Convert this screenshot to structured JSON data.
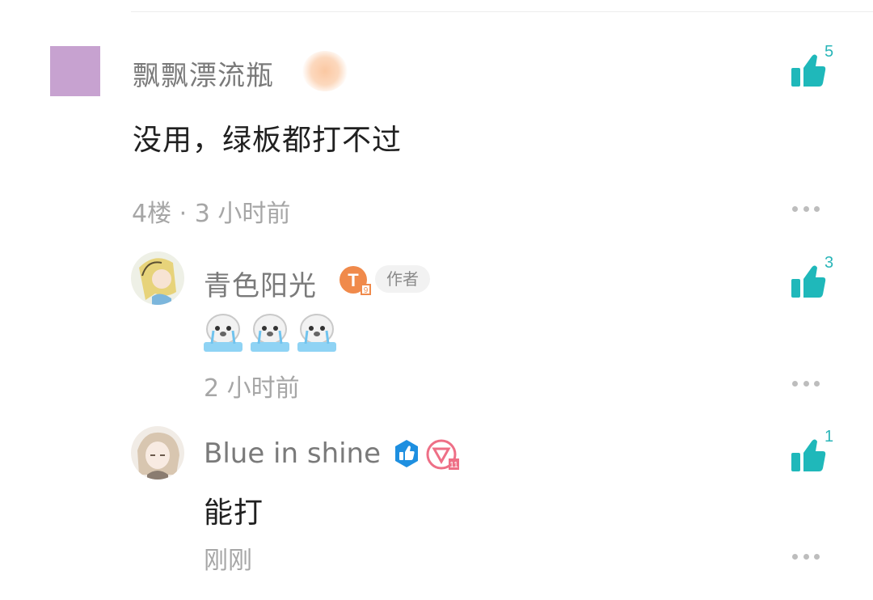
{
  "comments": [
    {
      "username": "飘飘漂流瓶",
      "text": "没用，绿板都打不过",
      "meta": "4楼 · 3 小时前",
      "likes": "5",
      "avatar_color": "#c7a2d0"
    }
  ],
  "replies": [
    {
      "username": "青色阳光",
      "author_badge": "作者",
      "level_badge": "T",
      "emoji_count": 3,
      "meta": "2 小时前",
      "likes": "3"
    },
    {
      "username": "Blue in shine",
      "text": "能打",
      "meta": "刚刚",
      "likes": "1"
    }
  ],
  "colors": {
    "accent": "#29b5b8",
    "like_icon": "#1fb8ba",
    "meta_text": "#a6a6a6",
    "name_text": "#7a7a7a",
    "level_badge_orange": "#f08a4b",
    "verified_blue": "#1e8fe0",
    "pink_badge": "#ee6f86"
  },
  "icons": {
    "like": "thumbs-up-icon",
    "more": "more-dots-icon"
  }
}
